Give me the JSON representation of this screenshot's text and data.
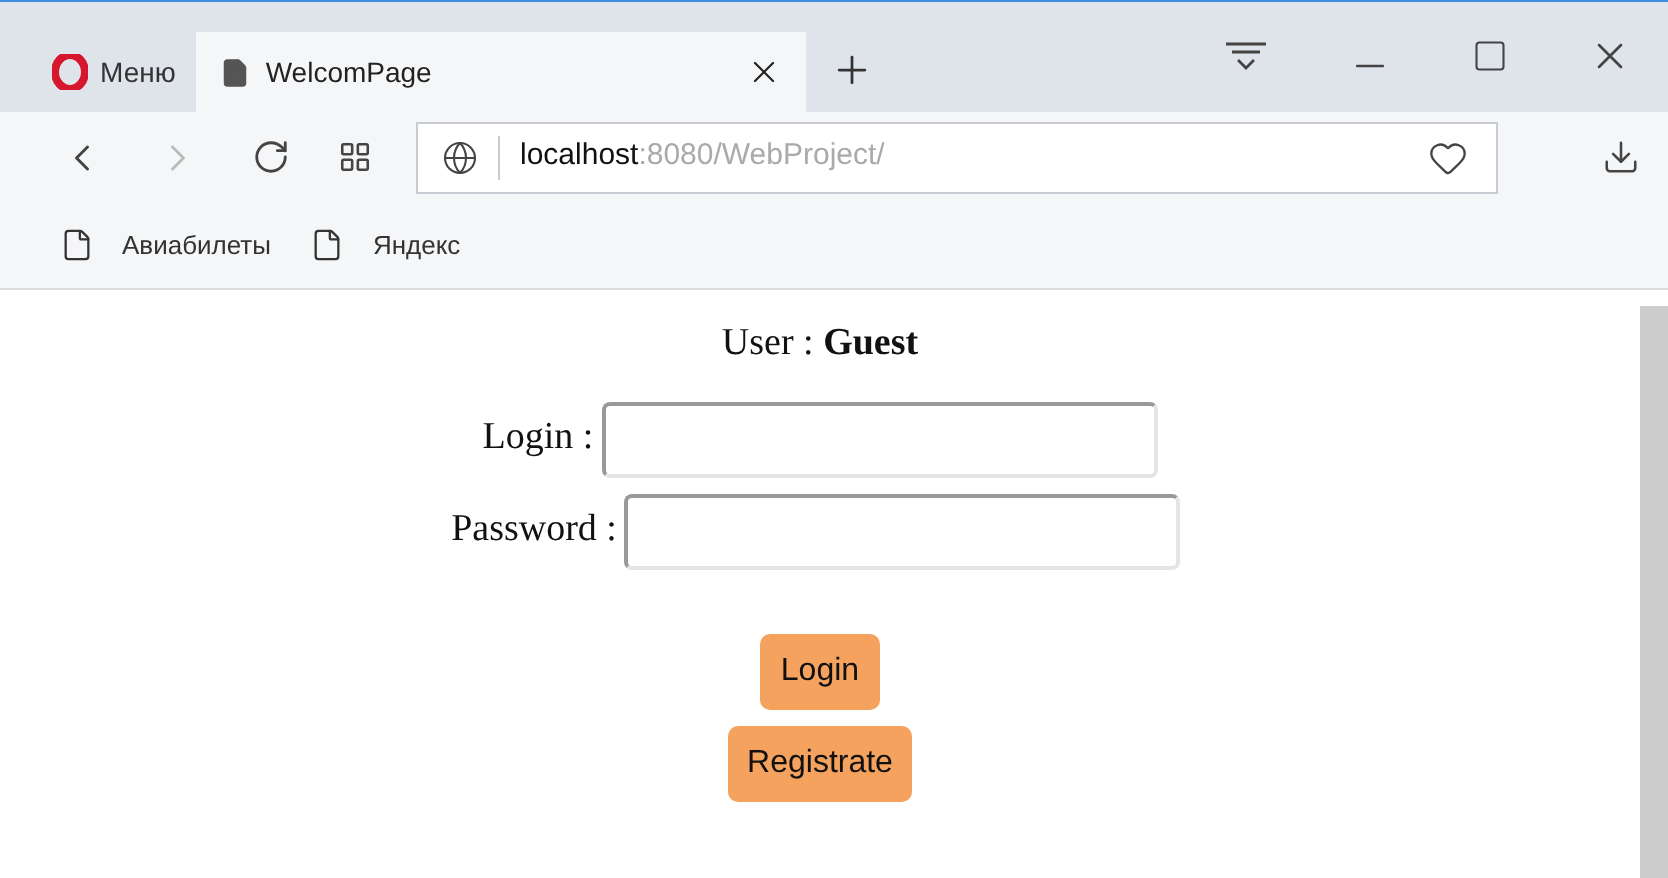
{
  "browser": {
    "menu_label": "Меню",
    "tabs": [
      {
        "label": "WelcomPage",
        "selected": true
      }
    ],
    "address": {
      "host": "localhost",
      "path": ":8080/WebProject/"
    },
    "bookmarks": [
      "Авиабилеты",
      "Яндекс"
    ]
  },
  "page": {
    "user_label": "User : ",
    "user_name": "Guest",
    "fields": [
      {
        "label": "Login :"
      },
      {
        "label": "Password :"
      }
    ],
    "buttons": [
      "Login",
      "Registrate"
    ]
  }
}
